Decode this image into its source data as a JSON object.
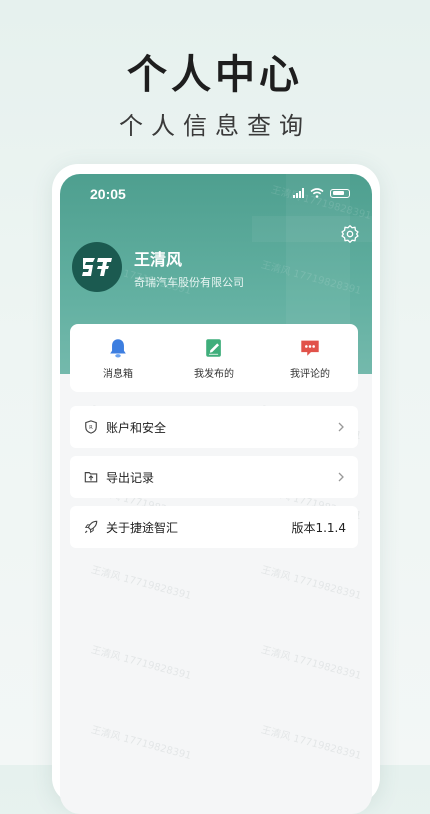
{
  "promo": {
    "title": "个人中心",
    "subtitle": "个人信息查询"
  },
  "status_bar": {
    "time": "20:05"
  },
  "profile": {
    "name": "王清风",
    "company": "奇瑞汽车股份有限公司"
  },
  "quick_actions": [
    {
      "label": "消息箱",
      "icon": "bell-icon",
      "color": "#3d7ee0"
    },
    {
      "label": "我发布的",
      "icon": "edit-document-icon",
      "color": "#3fae7b"
    },
    {
      "label": "我评论的",
      "icon": "comment-icon",
      "color": "#e1524a"
    }
  ],
  "menu": {
    "account_security": "账户和安全",
    "export_records": "导出记录",
    "about": "关于捷途智汇",
    "version": "版本1.1.4"
  },
  "watermark": "王清风 17719828391",
  "colors": {
    "header": "#55a596",
    "avatar_bg": "#1b5a50"
  }
}
